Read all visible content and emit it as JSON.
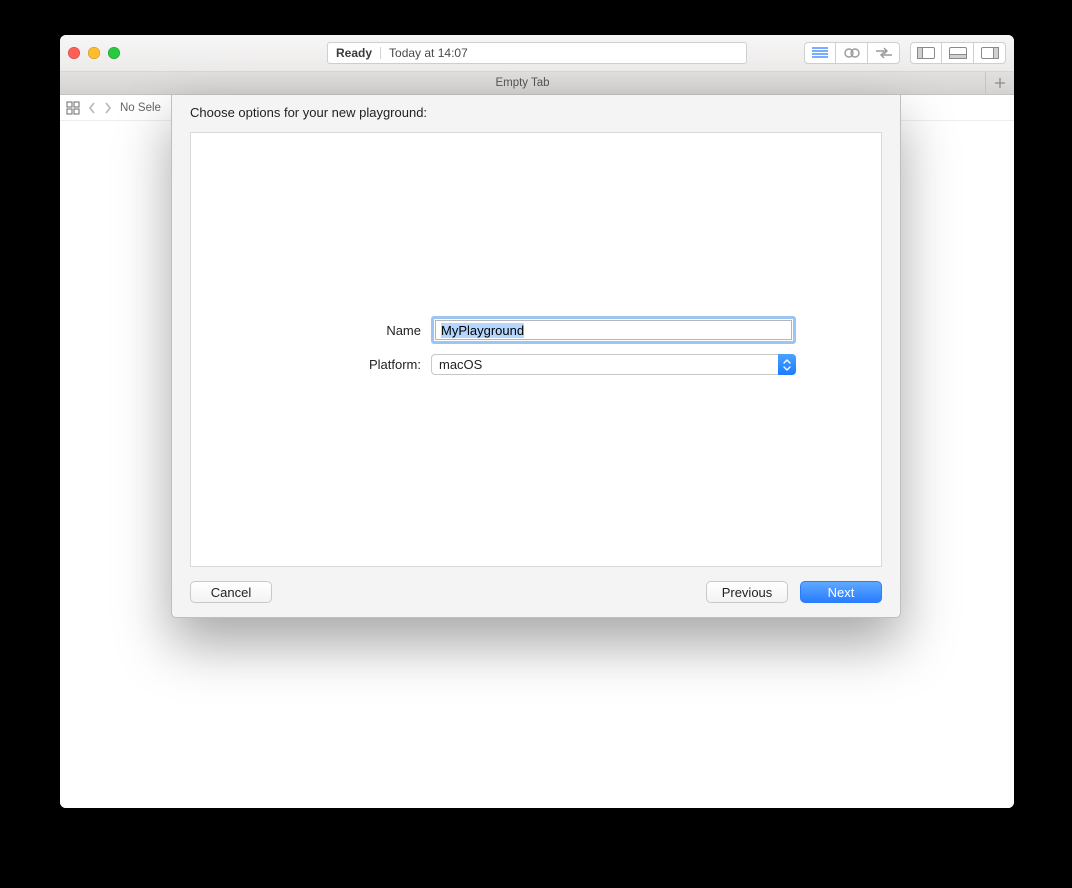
{
  "window": {
    "status_ready": "Ready",
    "status_time": "Today at 14:07"
  },
  "tabbar": {
    "tab_label": "Empty Tab"
  },
  "jumpbar": {
    "crumb": "No Sele"
  },
  "sheet": {
    "title": "Choose options for your new playground:",
    "name_label": "Name",
    "name_value": "MyPlayground",
    "platform_label": "Platform:",
    "platform_value": "macOS",
    "cancel": "Cancel",
    "previous": "Previous",
    "next": "Next"
  }
}
